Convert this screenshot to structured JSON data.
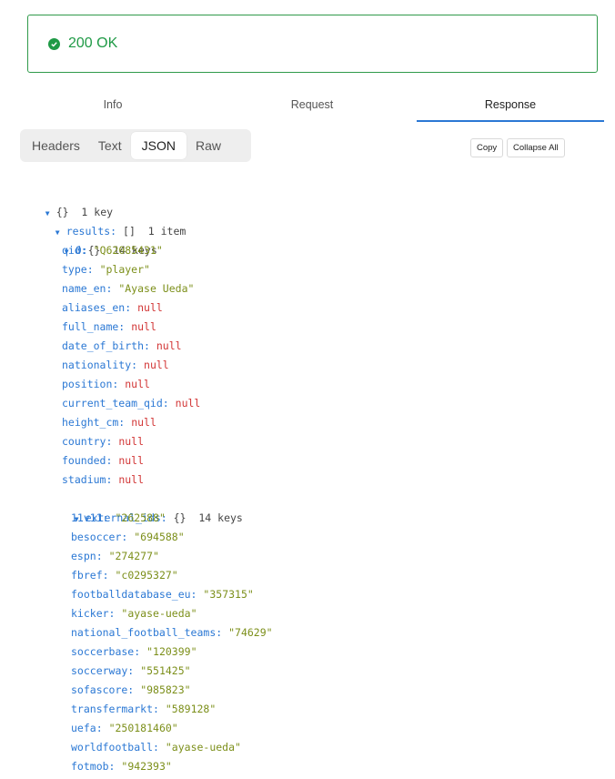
{
  "status": {
    "text": "200 OK",
    "color": "#1f9a46",
    "icon": "check-circle-icon"
  },
  "tabs": {
    "info": "Info",
    "request": "Request",
    "response": "Response",
    "active": "Response"
  },
  "view": {
    "headers": "Headers",
    "text": "Text",
    "json": "JSON",
    "raw": "Raw",
    "active": "JSON"
  },
  "actions": {
    "copy": "Copy",
    "collapse_all": "Collapse All"
  },
  "tree": {
    "root_brace": "{}",
    "root_meta": "1 key",
    "results_key": "results:",
    "results_brace": "[]",
    "results_meta": "1 item",
    "item_key": "0:",
    "item_brace": "{}",
    "item_meta": "14 keys",
    "fields": [
      {
        "key": "qid:",
        "value": "\"Q62085431\"",
        "type": "str"
      },
      {
        "key": "type:",
        "value": "\"player\"",
        "type": "str"
      },
      {
        "key": "name_en:",
        "value": "\"Ayase Ueda\"",
        "type": "str"
      },
      {
        "key": "aliases_en:",
        "value": "null",
        "type": "null"
      },
      {
        "key": "full_name:",
        "value": "null",
        "type": "null"
      },
      {
        "key": "date_of_birth:",
        "value": "null",
        "type": "null"
      },
      {
        "key": "nationality:",
        "value": "null",
        "type": "null"
      },
      {
        "key": "position:",
        "value": "null",
        "type": "null"
      },
      {
        "key": "current_team_qid:",
        "value": "null",
        "type": "null"
      },
      {
        "key": "height_cm:",
        "value": "null",
        "type": "null"
      },
      {
        "key": "country:",
        "value": "null",
        "type": "null"
      },
      {
        "key": "founded:",
        "value": "null",
        "type": "null"
      },
      {
        "key": "stadium:",
        "value": "null",
        "type": "null"
      }
    ],
    "external_key": "external_ids:",
    "external_brace": "{}",
    "external_meta": "14 keys",
    "external_ids": [
      {
        "key": "11v11:",
        "value": "\"262588\""
      },
      {
        "key": "besoccer:",
        "value": "\"694588\""
      },
      {
        "key": "espn:",
        "value": "\"274277\""
      },
      {
        "key": "fbref:",
        "value": "\"c0295327\""
      },
      {
        "key": "footballdatabase_eu:",
        "value": "\"357315\""
      },
      {
        "key": "kicker:",
        "value": "\"ayase-ueda\""
      },
      {
        "key": "national_football_teams:",
        "value": "\"74629\""
      },
      {
        "key": "soccerbase:",
        "value": "\"120399\""
      },
      {
        "key": "soccerway:",
        "value": "\"551425\""
      },
      {
        "key": "sofascore:",
        "value": "\"985823\""
      },
      {
        "key": "transfermarkt:",
        "value": "\"589128\""
      },
      {
        "key": "uefa:",
        "value": "\"250181460\""
      },
      {
        "key": "worldfootball:",
        "value": "\"ayase-ueda\""
      },
      {
        "key": "fotmob:",
        "value": "\"942393\""
      }
    ]
  }
}
